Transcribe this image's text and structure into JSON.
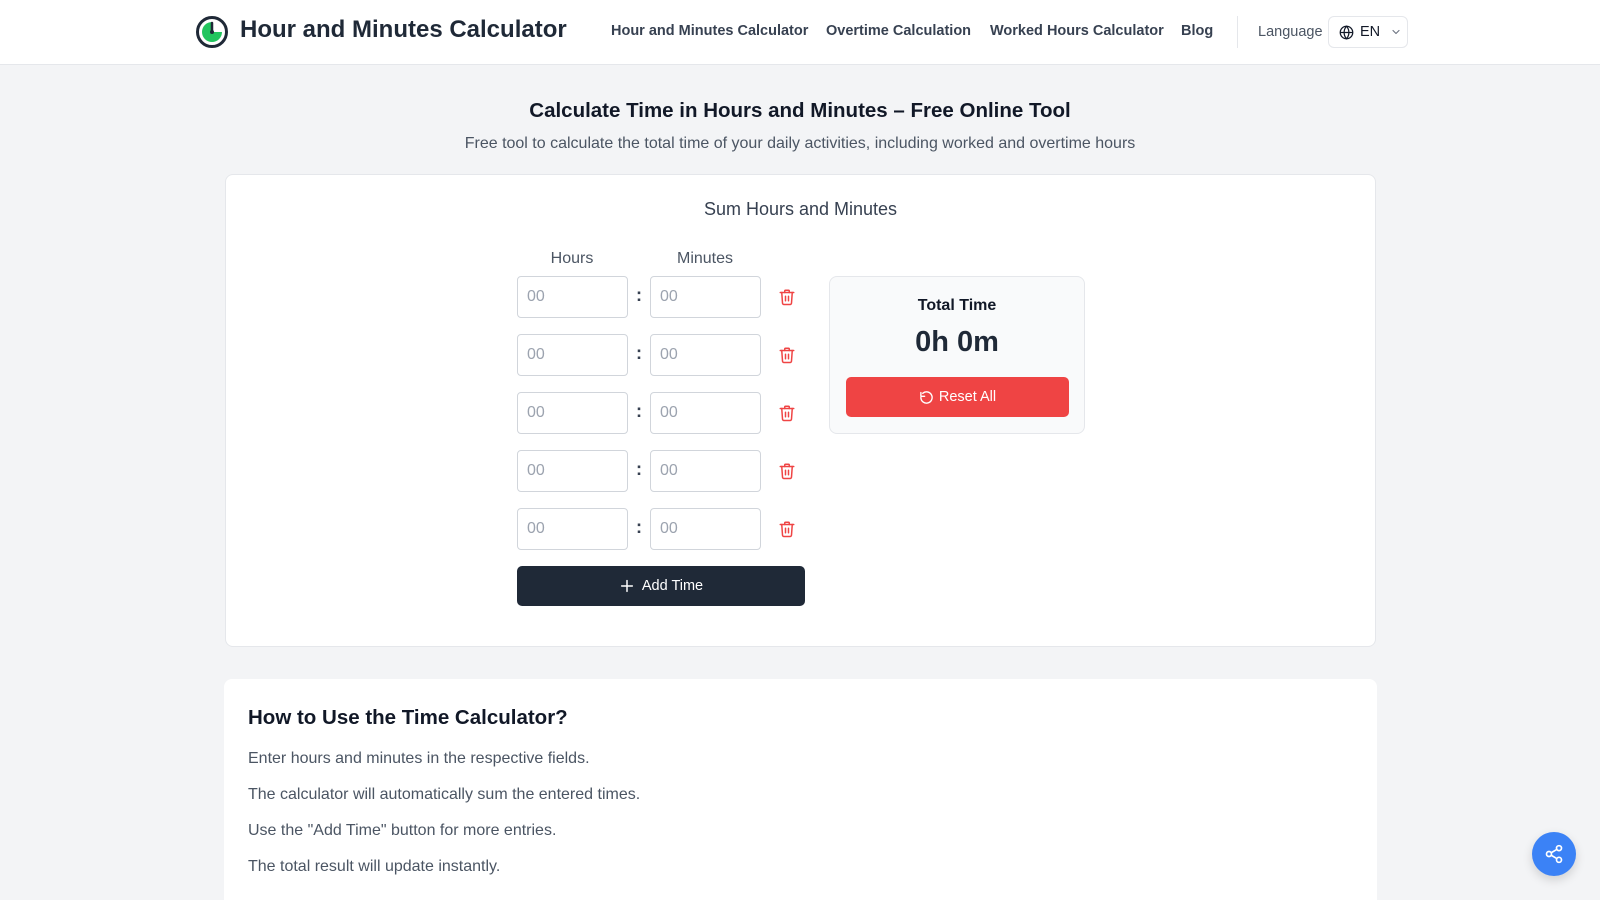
{
  "header": {
    "brand_title": "Hour and Minutes Calculator",
    "nav": [
      {
        "label": "Hour and Minutes Calculator"
      },
      {
        "label": "Overtime Calculation"
      },
      {
        "label": "Worked Hours Calculator"
      },
      {
        "label": "Blog"
      }
    ],
    "language_label": "Language",
    "language_code": "EN"
  },
  "hero": {
    "title": "Calculate Time in Hours and Minutes – Free Online Tool",
    "subtitle": "Free tool to calculate the total time of your daily activities, including worked and overtime hours"
  },
  "calculator": {
    "title": "Sum Hours and Minutes",
    "hours_header": "Hours",
    "minutes_header": "Minutes",
    "separator": ":",
    "rows": [
      {
        "hours": "",
        "minutes": "",
        "hours_placeholder": "00",
        "minutes_placeholder": "00"
      },
      {
        "hours": "",
        "minutes": "",
        "hours_placeholder": "00",
        "minutes_placeholder": "00"
      },
      {
        "hours": "",
        "minutes": "",
        "hours_placeholder": "00",
        "minutes_placeholder": "00"
      },
      {
        "hours": "",
        "minutes": "",
        "hours_placeholder": "00",
        "minutes_placeholder": "00"
      },
      {
        "hours": "",
        "minutes": "",
        "hours_placeholder": "00",
        "minutes_placeholder": "00"
      }
    ],
    "add_button_label": "Add Time",
    "total_label": "Total Time",
    "total_value": "0h 0m",
    "reset_button_label": "Reset All"
  },
  "howto": {
    "title": "How to Use the Time Calculator?",
    "steps": [
      "Enter hours and minutes in the respective fields.",
      "The calculator will automatically sum the entered times.",
      "Use the \"Add Time\" button for more entries.",
      "The total result will update instantly."
    ]
  },
  "colors": {
    "brand_green": "#22c55e",
    "dark": "#1f2937",
    "danger": "#ef4444",
    "share_blue": "#3b82f6"
  },
  "icons": {
    "logo": "clock-icon",
    "language": "globe-icon",
    "dropdown": "chevron-down-icon",
    "delete": "trash-icon",
    "add": "plus-icon",
    "reset": "rotate-ccw-icon",
    "share": "share-icon"
  }
}
